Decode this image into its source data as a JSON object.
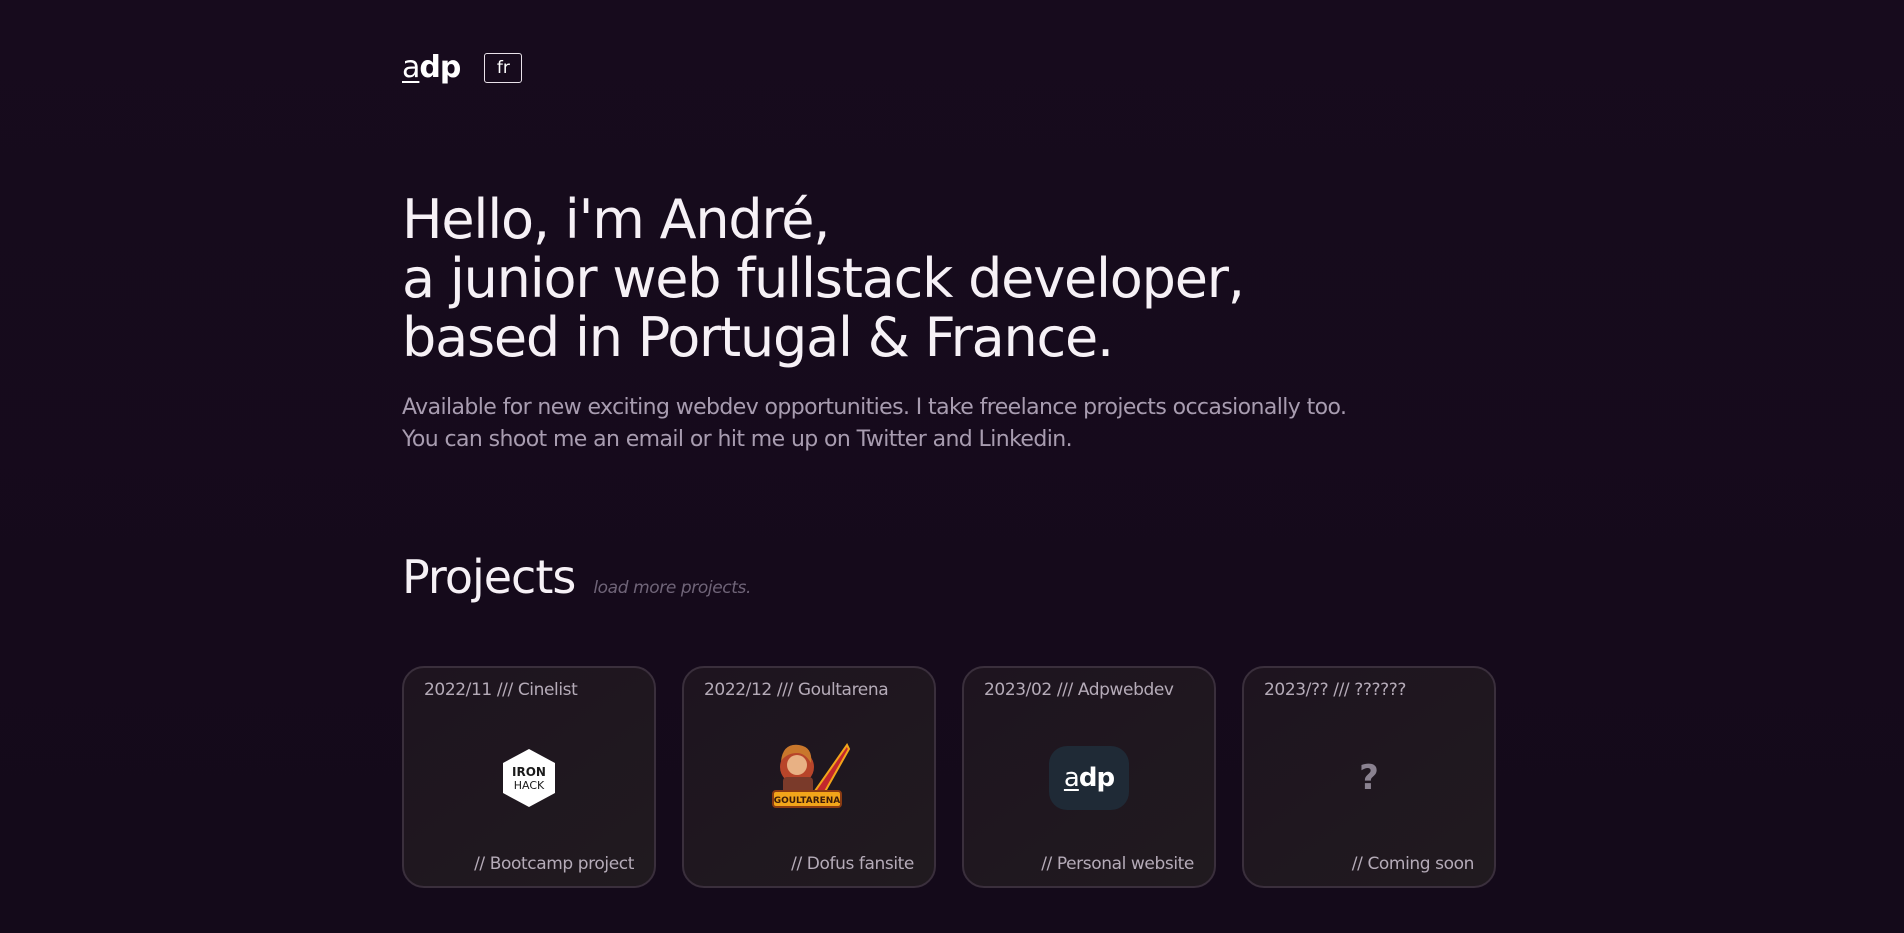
{
  "header": {
    "logo_first": "a",
    "logo_rest": "dp",
    "lang_button": "fr"
  },
  "hero": {
    "line1": "Hello, i'm André,",
    "line2": "a junior web fullstack developer,",
    "line3": "based in Portugal & France.",
    "sub1": "Available for new exciting webdev opportunities. I take freelance projects occasionally too.",
    "sub2": "You can shoot me an email or hit me up on Twitter and Linkedin."
  },
  "projects": {
    "title": "Projects",
    "load_more": "load more projects.",
    "cards": [
      {
        "date_title": "2022/11 /// Cinelist",
        "footer": "// Bootcamp project",
        "logo_line1": "IRON",
        "logo_line2": "HACK"
      },
      {
        "date_title": "2022/12 /// Goultarena",
        "footer": "// Dofus fansite",
        "logo_text": "GOULTARENA"
      },
      {
        "date_title": "2023/02 /// Adpwebdev",
        "footer": "// Personal website",
        "logo_first": "a",
        "logo_rest": "dp"
      },
      {
        "date_title": "2023/?? /// ??????",
        "footer": "// Coming soon",
        "logo_text": "?"
      }
    ]
  }
}
